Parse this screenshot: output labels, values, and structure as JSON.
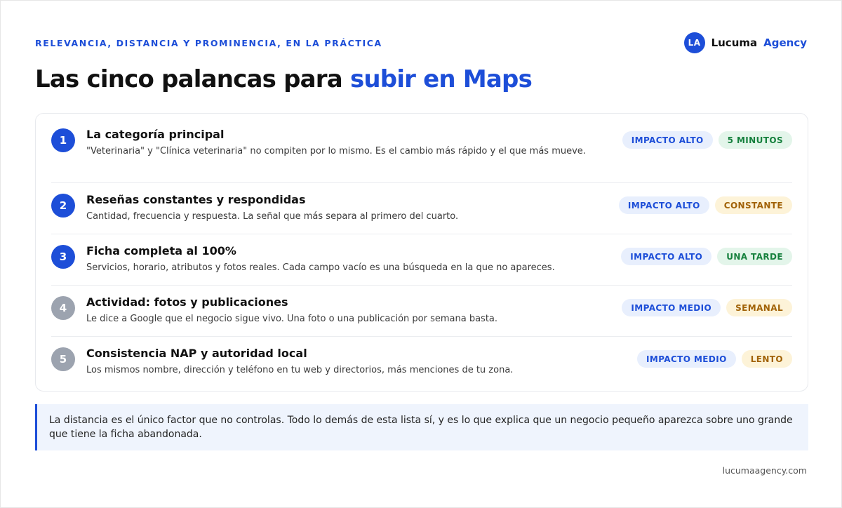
{
  "header": {
    "eyebrow": "RELEVANCIA, DISTANCIA Y PROMINENCIA, EN LA PRÁCTICA",
    "title_main": "Las cinco palancas para ",
    "title_accent": "subir en Maps"
  },
  "brand": {
    "logo_text": "LA",
    "name": "Lucuma",
    "accent": "Agency"
  },
  "items": [
    {
      "number": "1",
      "title": "La categoría principal",
      "description": "\"Veterinaria\" y \"Clínica veterinaria\" no compiten por lo mismo. Es el cambio más rápido y el que más mueve.",
      "impact": "IMPACTO ALTO",
      "effort": "5 MINUTOS"
    },
    {
      "number": "2",
      "title": "Reseñas constantes y respondidas",
      "description": "Cantidad, frecuencia y respuesta. La señal que más separa al primero del cuarto.",
      "impact": "IMPACTO ALTO",
      "effort": "CONSTANTE"
    },
    {
      "number": "3",
      "title": "Ficha completa al 100%",
      "description": "Servicios, horario, atributos y fotos reales. Cada campo vacío es una búsqueda en la que no apareces.",
      "impact": "IMPACTO ALTO",
      "effort": "UNA TARDE"
    },
    {
      "number": "4",
      "title": "Actividad: fotos y publicaciones",
      "description": "Le dice a Google que el negocio sigue vivo. Una foto o una publicación por semana basta.",
      "impact": "IMPACTO MEDIO",
      "effort": "SEMANAL"
    },
    {
      "number": "5",
      "title": "Consistencia NAP y autoridad local",
      "description": "Los mismos nombre, dirección y teléfono en tu web y directorios, más menciones de tu zona.",
      "impact": "IMPACTO MEDIO",
      "effort": "LENTO"
    }
  ],
  "note": "La distancia es el único factor que no controlas. Todo lo demás de esta lista sí, y es lo que explica que un negocio pequeño aparezca sobre uno grande que tiene la ficha abandonada.",
  "footer": "lucumaagency.com",
  "colors": {
    "accent": "#1d4ed8",
    "number_active": "#1d4ed8",
    "number_muted": "#9ca3af",
    "tag_green": "#15803d",
    "tag_amber": "#a16207"
  }
}
